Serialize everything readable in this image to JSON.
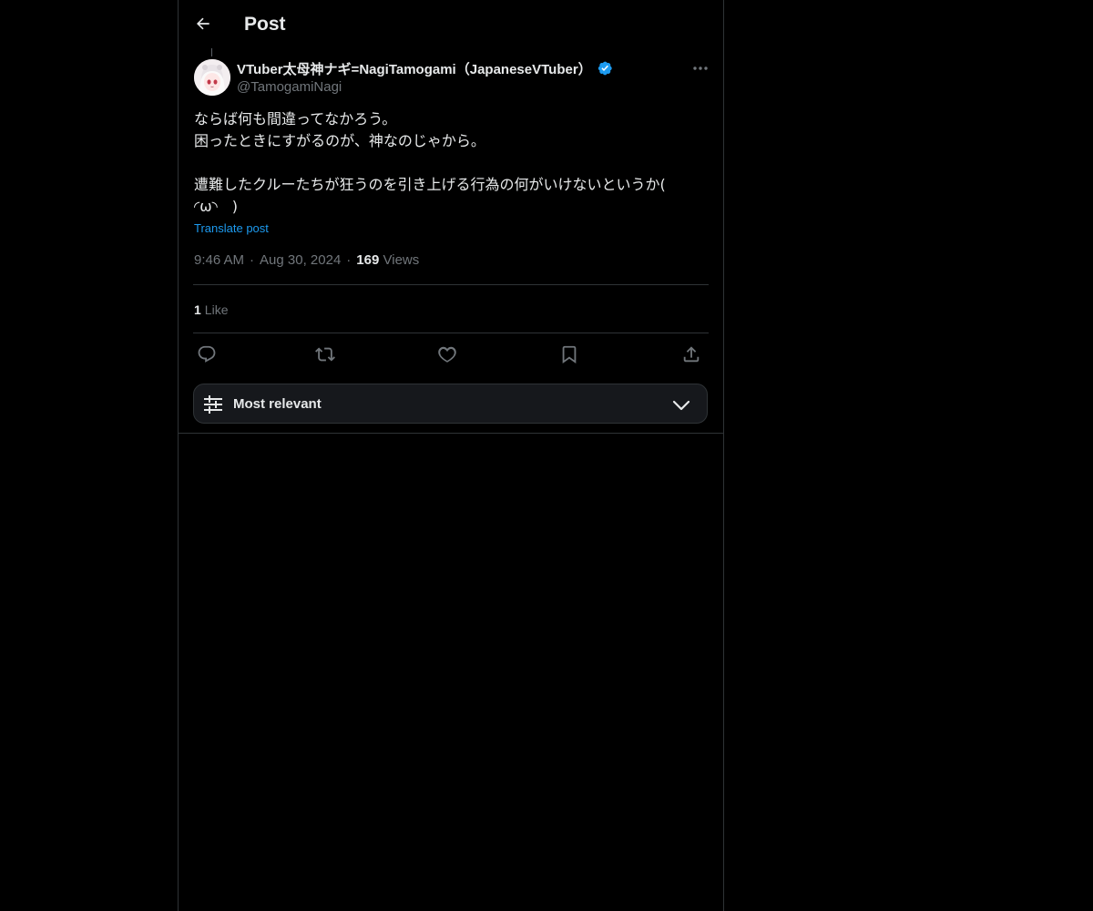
{
  "header": {
    "title": "Post"
  },
  "post": {
    "author_name": "VTuber太母神ナギ=NagiTamogami（JapaneseVTuber）",
    "handle": "@TamogamiNagi",
    "verified": true,
    "text_line1": "ならば何も間違ってなかろう。",
    "text_line2": "困ったときにすがるのが、神なのじゃから。",
    "text_line3": "",
    "text_line4": "遭難したクルーたちが狂うのを引き上げる行為の何がいけないというか(",
    "text_line5": "◜ω◝　)",
    "translate_label": "Translate post",
    "time": "9:46 AM",
    "date": "Aug 30, 2024",
    "views_count": "169",
    "views_label": "Views",
    "likes_count": "1",
    "likes_label": "Like"
  },
  "actions": [
    {
      "name": "reply",
      "icon": "reply-icon"
    },
    {
      "name": "repost",
      "icon": "repost-icon"
    },
    {
      "name": "like",
      "icon": "heart-icon"
    },
    {
      "name": "bookmark",
      "icon": "bookmark-icon"
    },
    {
      "name": "share",
      "icon": "share-icon"
    }
  ],
  "sort": {
    "label": "Most relevant",
    "icon": "sliders-icon"
  },
  "colors": {
    "background": "#000000",
    "text_primary": "#e7e9ea",
    "text_secondary": "#71767b",
    "accent": "#1d9bf0",
    "border": "#2f3336"
  }
}
